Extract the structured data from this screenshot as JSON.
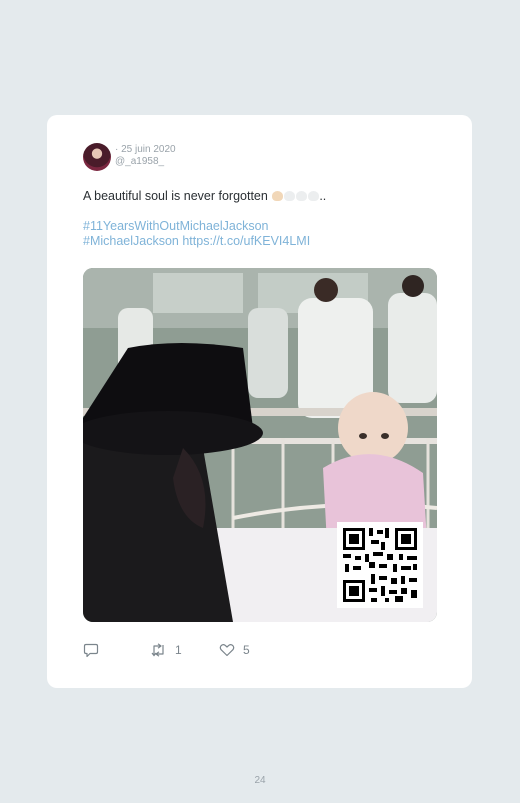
{
  "tweet": {
    "date": "· 25 juin 2020",
    "handle": "@_a1958_",
    "text": "A beautiful soul is never forgotten",
    "trailing": "..",
    "hashtag_line1": "#11YearsWithOutMichaelJackson",
    "hashtag_line2": "#MichaelJackson https://t.co/ufKEVI4LMI"
  },
  "actions": {
    "reply_icon": "reply-icon",
    "retweet_icon": "retweet-icon",
    "retweet_count": "1",
    "like_icon": "heart-icon",
    "like_count": "5"
  },
  "colors": {
    "background": "#e4eaed",
    "card": "#ffffff",
    "link": "#7fb3d8",
    "muted": "#9aa3aa"
  },
  "page": {
    "number": "24"
  }
}
